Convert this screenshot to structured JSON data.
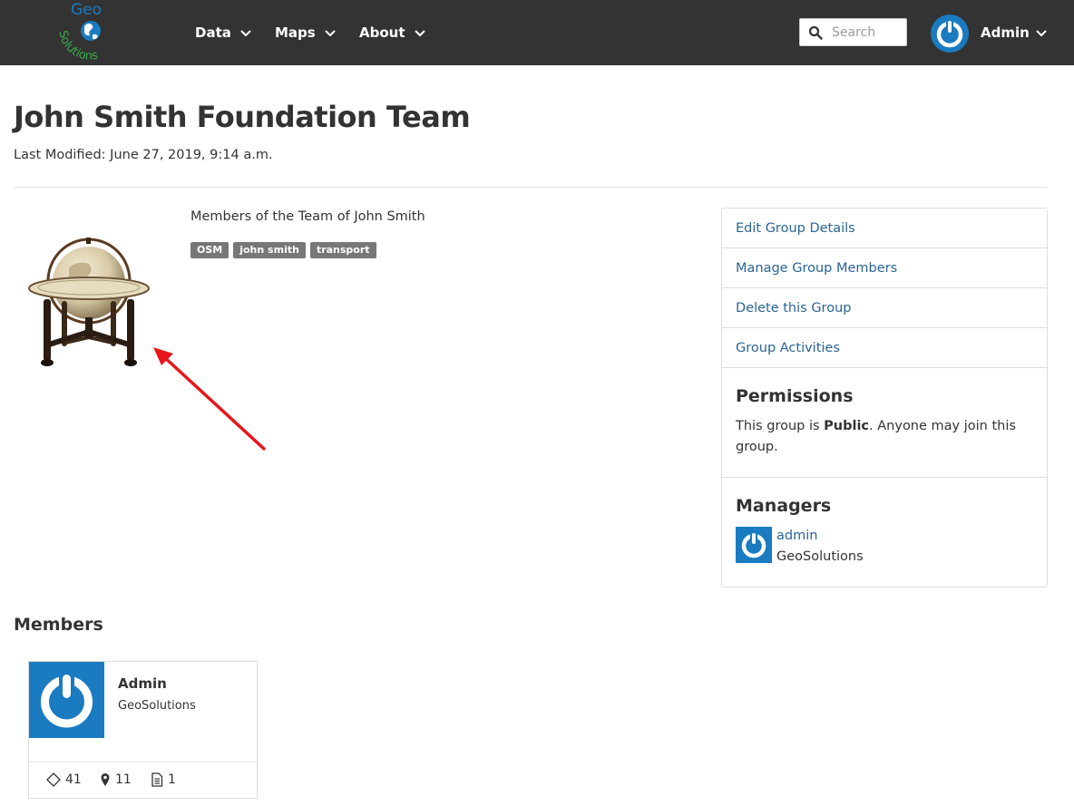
{
  "navbar": {
    "logo_text_top": "Geo",
    "logo_text_bottom": "Solutions",
    "menu": [
      {
        "label": "Data"
      },
      {
        "label": "Maps"
      },
      {
        "label": "About"
      }
    ],
    "search_placeholder": "Search",
    "user_label": "Admin"
  },
  "page": {
    "title": "John Smith Foundation Team",
    "last_modified": "Last Modified: June 27, 2019, 9:14 a.m.",
    "description": "Members of the Team of John Smith",
    "keywords": [
      "OSM",
      "john smith",
      "transport"
    ]
  },
  "panel": {
    "links": [
      {
        "label": "Edit Group Details"
      },
      {
        "label": "Manage Group Members"
      },
      {
        "label": "Delete this Group"
      },
      {
        "label": "Group Activities"
      }
    ],
    "permissions_title": "Permissions",
    "permissions_prefix": "This group is ",
    "permissions_level": "Public",
    "permissions_suffix": ". Anyone may join this group.",
    "managers_title": "Managers",
    "manager_name": "admin",
    "manager_org": "GeoSolutions"
  },
  "members": {
    "title": "Members",
    "items": [
      {
        "name": "Admin",
        "org": "GeoSolutions",
        "layers_count": "41",
        "maps_count": "11",
        "documents_count": "1"
      }
    ]
  },
  "colors": {
    "navbar_bg": "#333333",
    "link": "#2a6496",
    "avatar_blue": "#1a7bc1",
    "keyword_bg": "#777777",
    "annotation_red": "#e8161b"
  }
}
